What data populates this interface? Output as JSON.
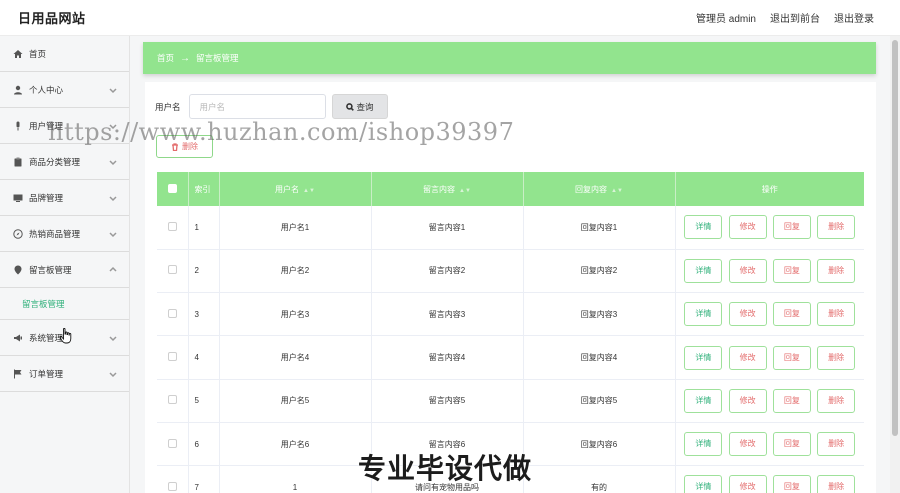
{
  "header": {
    "brand": "日用品网站",
    "admin_label": "管理员 admin",
    "to_front_label": "退出到前台",
    "logout_label": "退出登录"
  },
  "sidebar": {
    "items": [
      {
        "label": "首页",
        "icon": "home-icon"
      },
      {
        "label": "个人中心",
        "icon": "user-icon"
      },
      {
        "label": "用户管理",
        "icon": "mic-icon"
      },
      {
        "label": "商品分类管理",
        "icon": "clipboard-icon"
      },
      {
        "label": "品牌管理",
        "icon": "monitor-icon"
      },
      {
        "label": "热销商品管理",
        "icon": "compass-icon"
      },
      {
        "label": "留言板管理",
        "icon": "location-icon",
        "expanded": true
      },
      {
        "label": "系统管理",
        "icon": "megaphone-icon"
      },
      {
        "label": "订单管理",
        "icon": "flag-icon"
      }
    ],
    "submenu_active": "留言板管理"
  },
  "breadcrumb": {
    "home": "首页",
    "current": "留言板管理"
  },
  "search": {
    "label": "用户名",
    "placeholder": "用户名",
    "button_label": "查询"
  },
  "toolbar": {
    "delete_label": "删除"
  },
  "table": {
    "headers": {
      "index": "索引",
      "username": "用户名",
      "message": "留言内容",
      "reply": "回复内容",
      "actions": "操作"
    },
    "action_labels": {
      "detail": "详情",
      "edit": "修改",
      "reply": "回复",
      "delete": "删除"
    },
    "rows": [
      {
        "index": "1",
        "username": "用户名1",
        "message": "留言内容1",
        "reply": "回复内容1"
      },
      {
        "index": "2",
        "username": "用户名2",
        "message": "留言内容2",
        "reply": "回复内容2"
      },
      {
        "index": "3",
        "username": "用户名3",
        "message": "留言内容3",
        "reply": "回复内容3"
      },
      {
        "index": "4",
        "username": "用户名4",
        "message": "留言内容4",
        "reply": "回复内容4"
      },
      {
        "index": "5",
        "username": "用户名5",
        "message": "留言内容5",
        "reply": "回复内容5"
      },
      {
        "index": "6",
        "username": "用户名6",
        "message": "留言内容6",
        "reply": "回复内容6"
      },
      {
        "index": "7",
        "username": "1",
        "message": "请问有宠物用品吗",
        "reply": "有的"
      }
    ]
  },
  "overlay": {
    "watermark": "https://www.huzhan.com/ishop39397",
    "caption": "专业毕设代做"
  },
  "colors": {
    "accent_green": "#92e48e",
    "link_green": "#2fb07a",
    "danger_red": "#e36b6b"
  }
}
